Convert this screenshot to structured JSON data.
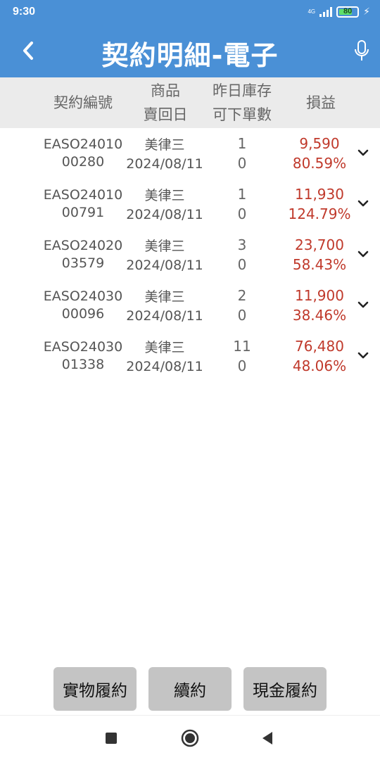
{
  "status_bar": {
    "time": "9:30",
    "battery": "80",
    "network": "4G"
  },
  "header": {
    "title": "契約明細-電子"
  },
  "columns": {
    "contract_no": "契約編號",
    "product": "商品",
    "sell_back_date": "賣回日",
    "prev_inventory": "昨日庫存",
    "orderable": "可下單數",
    "pnl": "損益"
  },
  "rows": [
    {
      "contract_line1": "EASO24010",
      "contract_line2": "00280",
      "product": "美律三",
      "date": "2024/08/11",
      "inventory": "1",
      "orderable": "0",
      "pnl": "9,590",
      "pnl_pct": "80.59%"
    },
    {
      "contract_line1": "EASO24010",
      "contract_line2": "00791",
      "product": "美律三",
      "date": "2024/08/11",
      "inventory": "1",
      "orderable": "0",
      "pnl": "11,930",
      "pnl_pct": "124.79%"
    },
    {
      "contract_line1": "EASO24020",
      "contract_line2": "03579",
      "product": "美律三",
      "date": "2024/08/11",
      "inventory": "3",
      "orderable": "0",
      "pnl": "23,700",
      "pnl_pct": "58.43%"
    },
    {
      "contract_line1": "EASO24030",
      "contract_line2": "00096",
      "product": "美律三",
      "date": "2024/08/11",
      "inventory": "2",
      "orderable": "0",
      "pnl": "11,900",
      "pnl_pct": "38.46%"
    },
    {
      "contract_line1": "EASO24030",
      "contract_line2": "01338",
      "product": "美律三",
      "date": "2024/08/11",
      "inventory": "11",
      "orderable": "0",
      "pnl": "76,480",
      "pnl_pct": "48.06%"
    }
  ],
  "buttons": {
    "physical": "實物履約",
    "renew": "續約",
    "cash": "現金履約"
  },
  "icons": {
    "back": "chevron-left-icon",
    "mic": "microphone-icon",
    "expand": "chevron-down-icon",
    "nav_recent": "square-icon",
    "nav_home": "circle-icon",
    "nav_back": "triangle-left-icon"
  },
  "colors": {
    "header_bg": "#4a90d6",
    "column_header_bg": "#ebebeb",
    "profit": "#c0392b",
    "button_bg": "#c4c4c4"
  }
}
